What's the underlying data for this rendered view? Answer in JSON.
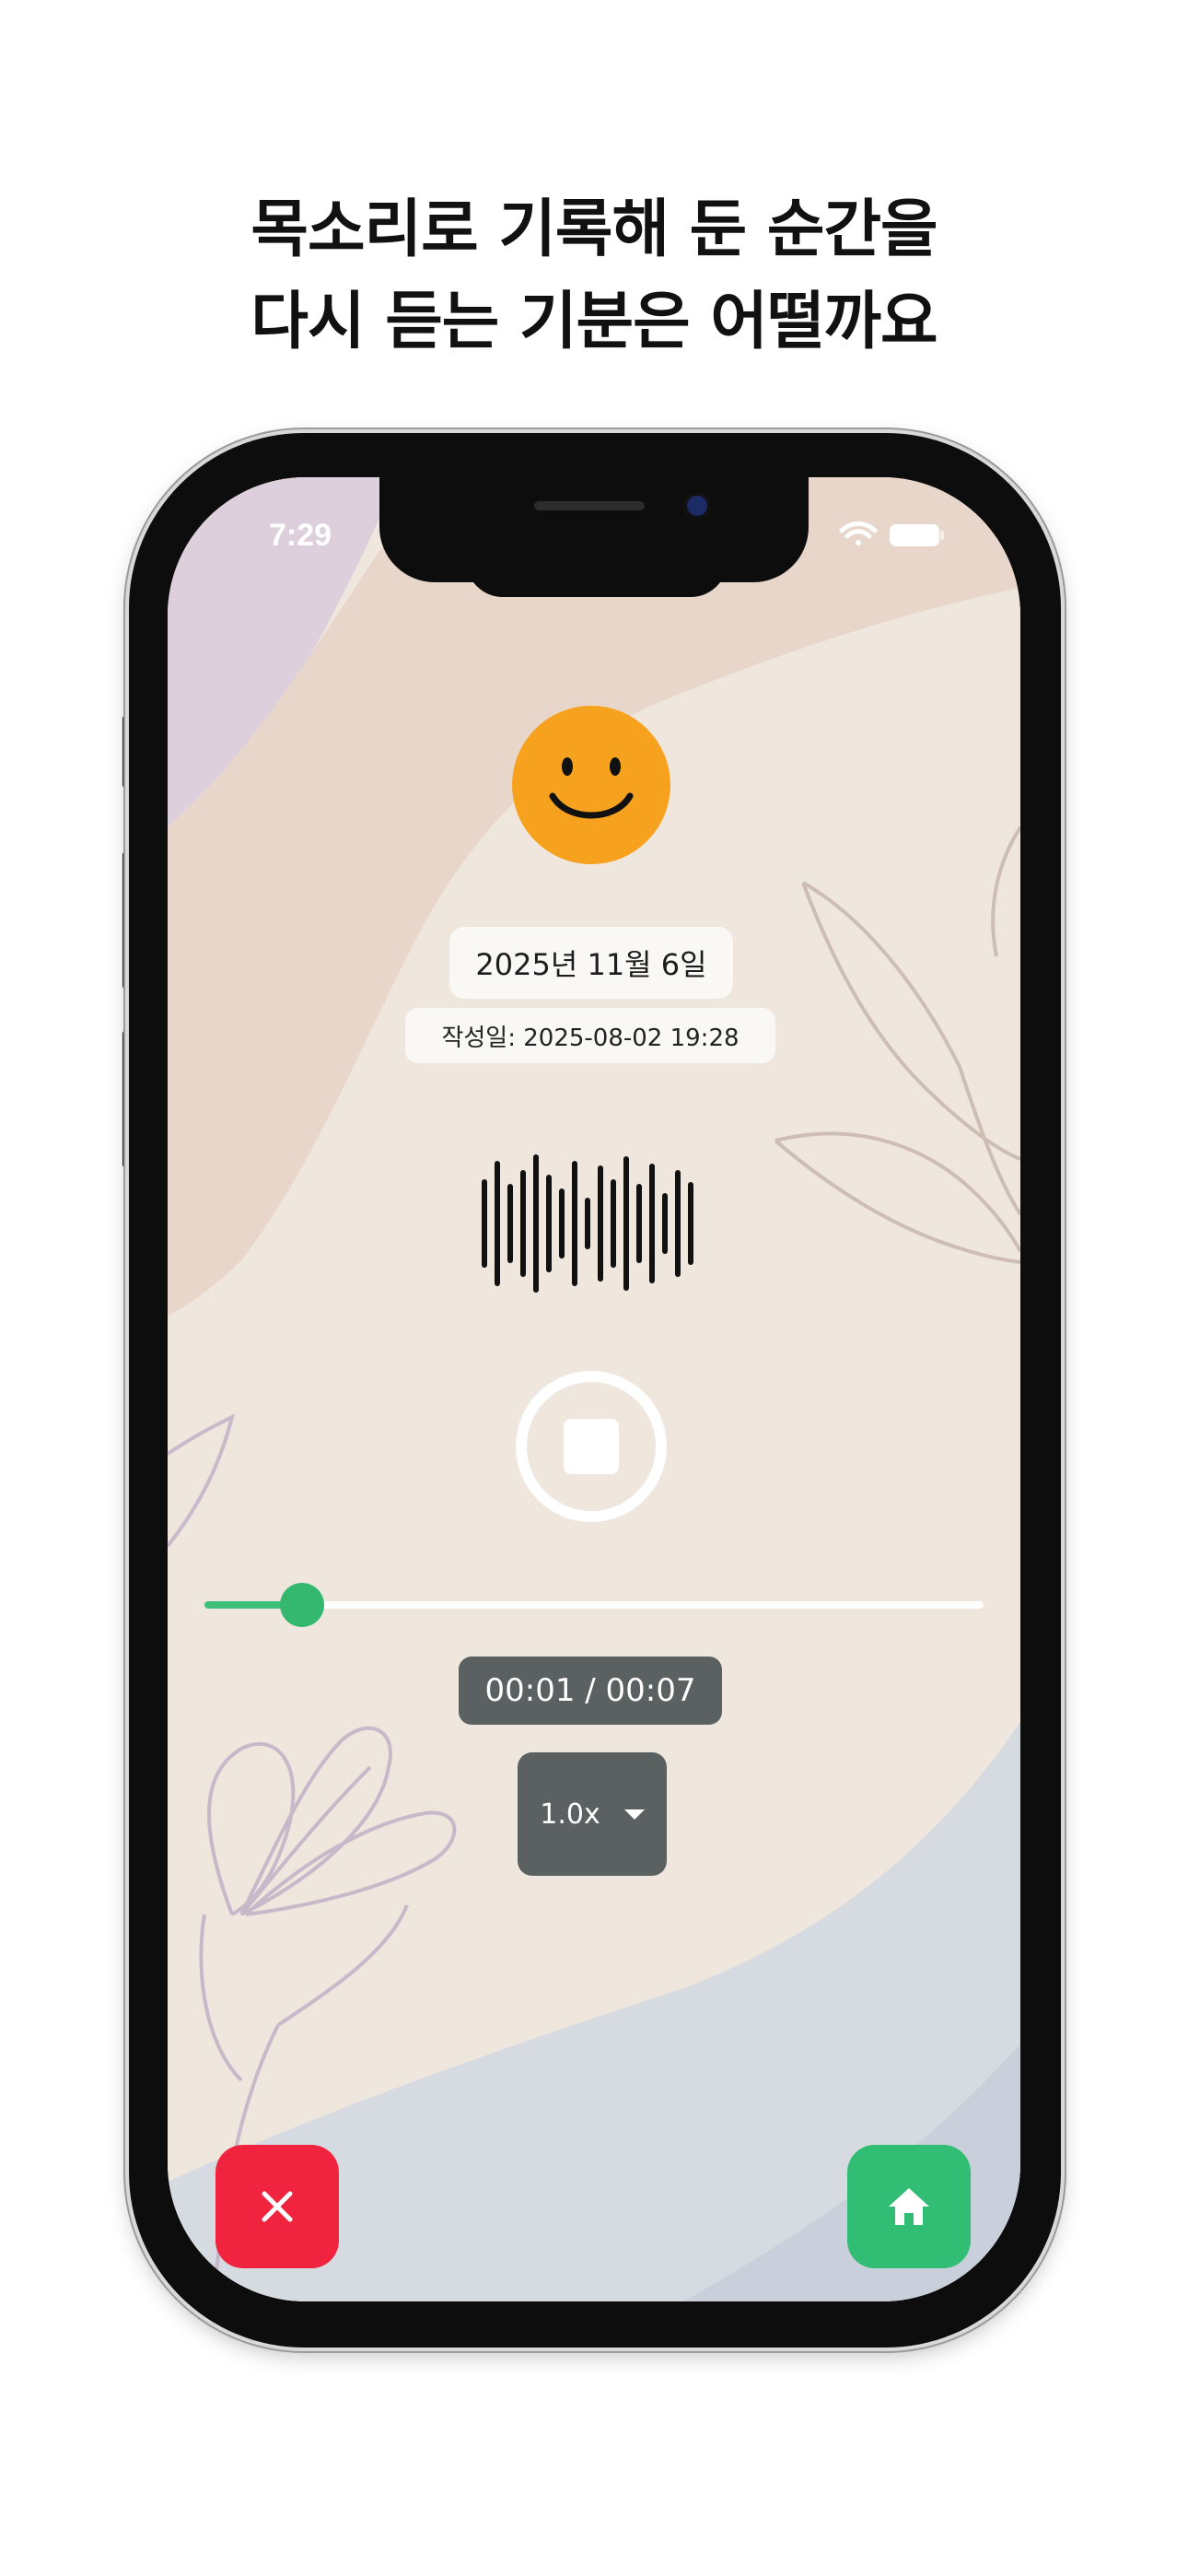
{
  "headline": {
    "line1": "목소리로 기록해 둔 순간을",
    "line2": "다시 듣는 기분은 어떨까요"
  },
  "status_bar": {
    "time": "7:29",
    "icons": [
      "wifi-icon",
      "battery-icon"
    ]
  },
  "record": {
    "mood_icon": "smiley-face-icon",
    "date": "2025년 11월 6일",
    "written_at": "작성일: 2025-08-02 19:28"
  },
  "player": {
    "waveform_icon": "voice-waveform-icon",
    "stop_icon": "stop-icon",
    "progress": 0.125,
    "elapsed": "00:01",
    "total": "00:07",
    "time_display": "00:01 / 00:07",
    "speed": "1.0x"
  },
  "actions": {
    "close_icon": "close-icon",
    "home_icon": "home-icon"
  },
  "colors": {
    "accent_green": "#34b86f",
    "danger_red": "#f0243e",
    "mood_orange": "#f7a21e",
    "chip_gray": "#5b6160"
  }
}
